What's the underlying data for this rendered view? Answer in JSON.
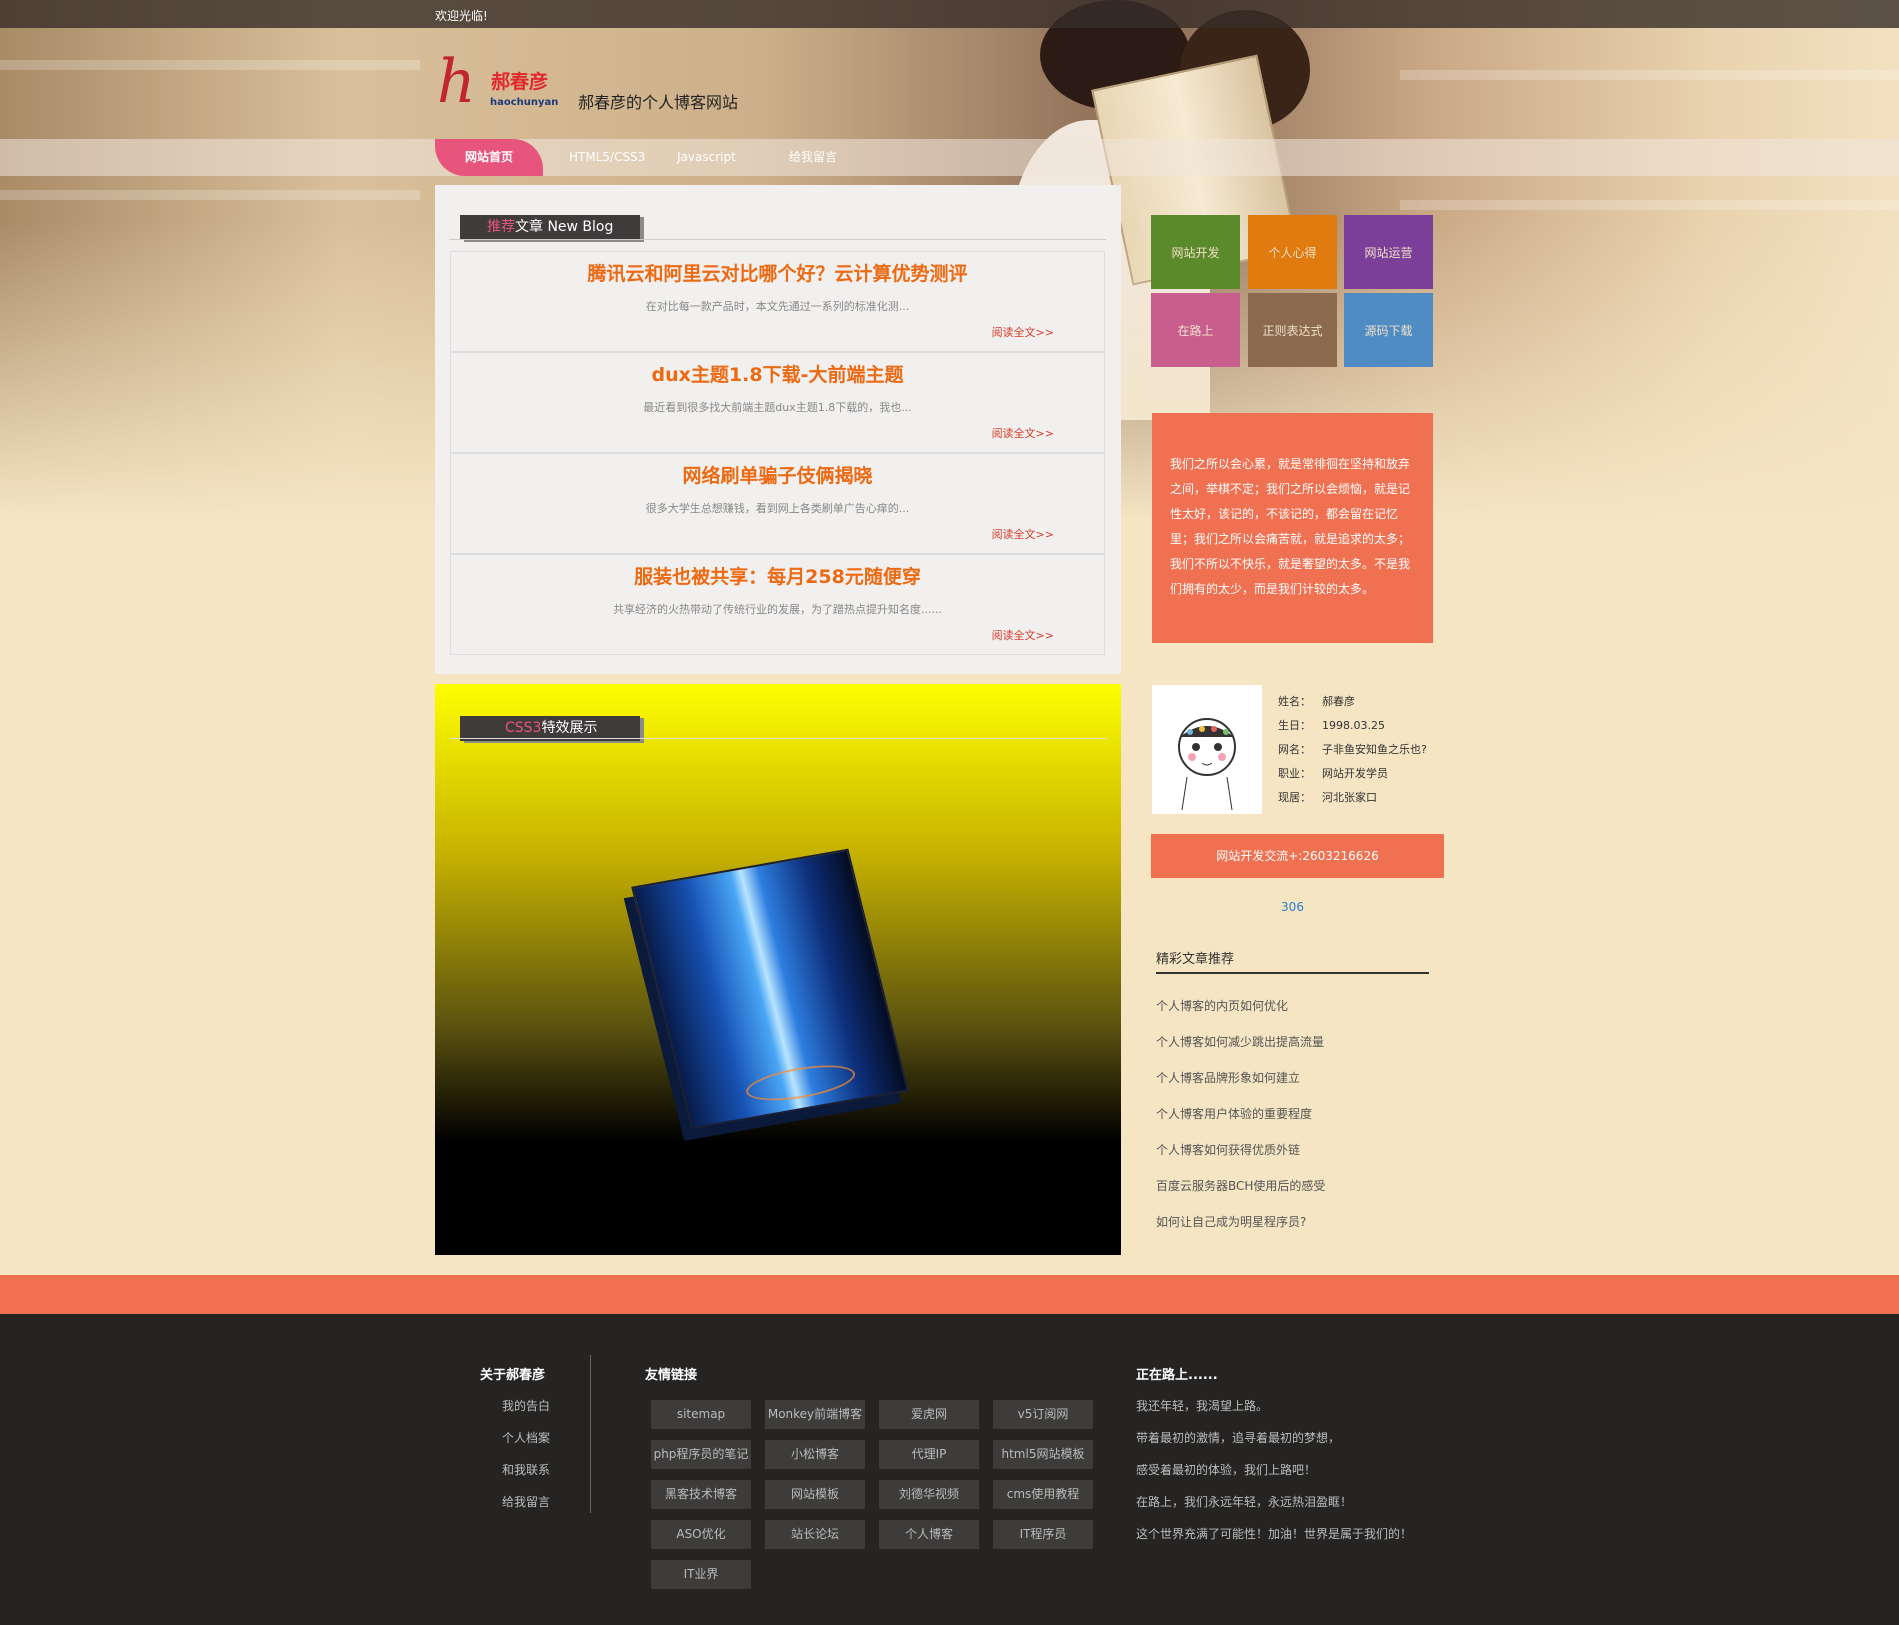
{
  "topbar": {
    "welcome": "欢迎光临!"
  },
  "logo": {
    "glyph": "h",
    "name": "郝春彦",
    "pinyin": "haochunyan"
  },
  "tagline": "郝春彦的个人博客网站",
  "nav": [
    "网站首页",
    "HTML5/CSS3",
    "Javascript",
    "给我留言"
  ],
  "blog": {
    "title_highlight": "推荐",
    "title_rest": "文章 New Blog",
    "posts": [
      {
        "title": "腾讯云和阿里云对比哪个好？云计算优势测评",
        "excerpt": "在对比每一款产品时，本文先通过一系列的标准化测...",
        "more": "阅读全文>>"
      },
      {
        "title": "dux主题1.8下载-大前端主题",
        "excerpt": "最近看到很多找大前端主题dux主题1.8下载的，我也...",
        "more": "阅读全文>>"
      },
      {
        "title": "网络刷单骗子伎俩揭晓",
        "excerpt": "很多大学生总想赚钱，看到网上各类刷单广告心痒的...",
        "more": "阅读全文>>"
      },
      {
        "title": "服装也被共享：每月258元随便穿",
        "excerpt": "共享经济的火热带动了传统行业的发展，为了蹭热点提升知名度......",
        "more": "阅读全文>>"
      }
    ]
  },
  "css3": {
    "title_highlight": "CSS3",
    "title_rest": "特效展示"
  },
  "tiles": [
    {
      "label": "网站开发",
      "color": "#5b8a2b"
    },
    {
      "label": "个人心得",
      "color": "#e07b10"
    },
    {
      "label": "网站运营",
      "color": "#7b3f9a"
    },
    {
      "label": "在路上",
      "color": "#c75e8e"
    },
    {
      "label": "正则表达式",
      "color": "#8b6a4e"
    },
    {
      "label": "源码下载",
      "color": "#4f8cc4"
    }
  ],
  "quote": "我们之所以会心累，就是常徘徊在坚持和放弃之间，举棋不定；我们之所以会烦恼，就是记性太好，该记的，不该记的，都会留在记忆里；我们之所以会痛苦就，就是追求的太多；我们不所以不快乐，就是奢望的太多。不是我们拥有的太少，而是我们计较的太多。",
  "profile": [
    {
      "label": "姓名：",
      "value": "郝春彦"
    },
    {
      "label": "生日：",
      "value": "1998.03.25"
    },
    {
      "label": "网名：",
      "value": "子非鱼安知鱼之乐也?"
    },
    {
      "label": "职业：",
      "value": "网站开发学员"
    },
    {
      "label": "现居：",
      "value": "河北张家口"
    }
  ],
  "qq": "网站开发交流+:2603216626",
  "counter": "306",
  "recommend": {
    "title": "精彩文章推荐",
    "items": [
      "个人博客的内页如何优化",
      "个人博客如何减少跳出提高流量",
      "个人博客品牌形象如何建立",
      "个人博客用户体验的重要程度",
      "个人博客如何获得优质外链",
      "百度云服务器BCH使用后的感受",
      "如何让自己成为明星程序员?"
    ]
  },
  "footer": {
    "about_title": "关于郝春彦",
    "about_links": [
      "我的告白",
      "个人档案",
      "和我联系",
      "给我留言"
    ],
    "links_title": "友情链接",
    "links": [
      "sitemap",
      "Monkey前端博客",
      "爱虎网",
      "v5订阅网",
      "php程序员的笔记",
      "小松博客",
      "代理IP",
      "html5网站模板",
      "黑客技术博客",
      "网站模板",
      "刘德华视频",
      "cms使用教程",
      "ASO优化",
      "站长论坛",
      "个人博客",
      "IT程序员",
      "IT业界"
    ],
    "road_title": "正在路上......",
    "road_lines": [
      "我还年轻，我渴望上路。",
      "带着最初的激情，追寻着最初的梦想，",
      "感受着最初的体验，我们上路吧！",
      "在路上，我们永远年轻，永远热泪盈眶！",
      "这个世界充满了可能性！加油！世界是属于我们的！"
    ]
  }
}
